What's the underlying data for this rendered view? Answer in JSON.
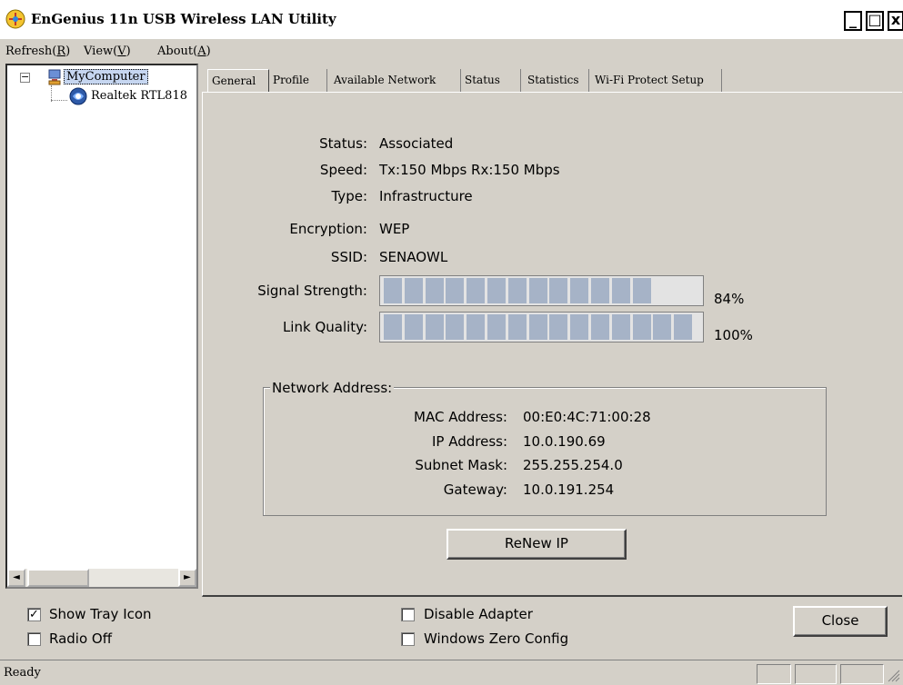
{
  "window": {
    "title": "EnGenius 11n USB Wireless LAN Utility",
    "buttons": {
      "minimize": "_",
      "maximize": "□",
      "close": "x"
    }
  },
  "menu": {
    "refresh": {
      "label": "Refresh(",
      "key": "R",
      "end": ")"
    },
    "view": {
      "label": "View(",
      "key": "V",
      "end": ")"
    },
    "about": {
      "label": "About(",
      "key": "A",
      "end": ")"
    }
  },
  "tree": {
    "expander": "−",
    "root": "MyComputer",
    "child": "Realtek RTL818",
    "scroll_left": "◄",
    "scroll_right": "►"
  },
  "tabs": [
    "General",
    "Profile",
    "Available Network",
    "Status",
    "Statistics",
    "Wi-Fi Protect Setup"
  ],
  "general": {
    "status_label": "Status:",
    "status_value": "Associated",
    "speed_label": "Speed:",
    "speed_value": "Tx:150 Mbps Rx:150 Mbps",
    "type_label": "Type:",
    "type_value": "Infrastructure",
    "encryption_label": "Encryption:",
    "encryption_value": "WEP",
    "ssid_label": "SSID:",
    "ssid_value": "SENAOWL",
    "signal_label": "Signal Strength:",
    "signal_text": "84%",
    "signal_percent": 84,
    "link_label": "Link Quality:",
    "link_text": "100%",
    "link_percent": 100
  },
  "network_address": {
    "title": "Network Address:",
    "mac_label": "MAC Address:",
    "mac_value": "00:E0:4C:71:00:28",
    "ip_label": "IP Address:",
    "ip_value": "10.0.190.69",
    "subnet_label": "Subnet Mask:",
    "subnet_value": "255.255.254.0",
    "gateway_label": "Gateway:",
    "gateway_value": "10.0.191.254"
  },
  "renew_button": "ReNew IP",
  "options": {
    "show_tray": {
      "label": "Show Tray Icon",
      "checked": true
    },
    "radio_off": {
      "label": "Radio Off",
      "checked": false
    },
    "disable_adapter": {
      "label": "Disable Adapter",
      "checked": false
    },
    "zero_config": {
      "label": "Windows Zero Config",
      "checked": false
    }
  },
  "close_button": "Close",
  "status_bar": {
    "text": "Ready"
  },
  "colors": {
    "face": "#d4d0c8",
    "bar_fill": "#a6b3c7"
  }
}
